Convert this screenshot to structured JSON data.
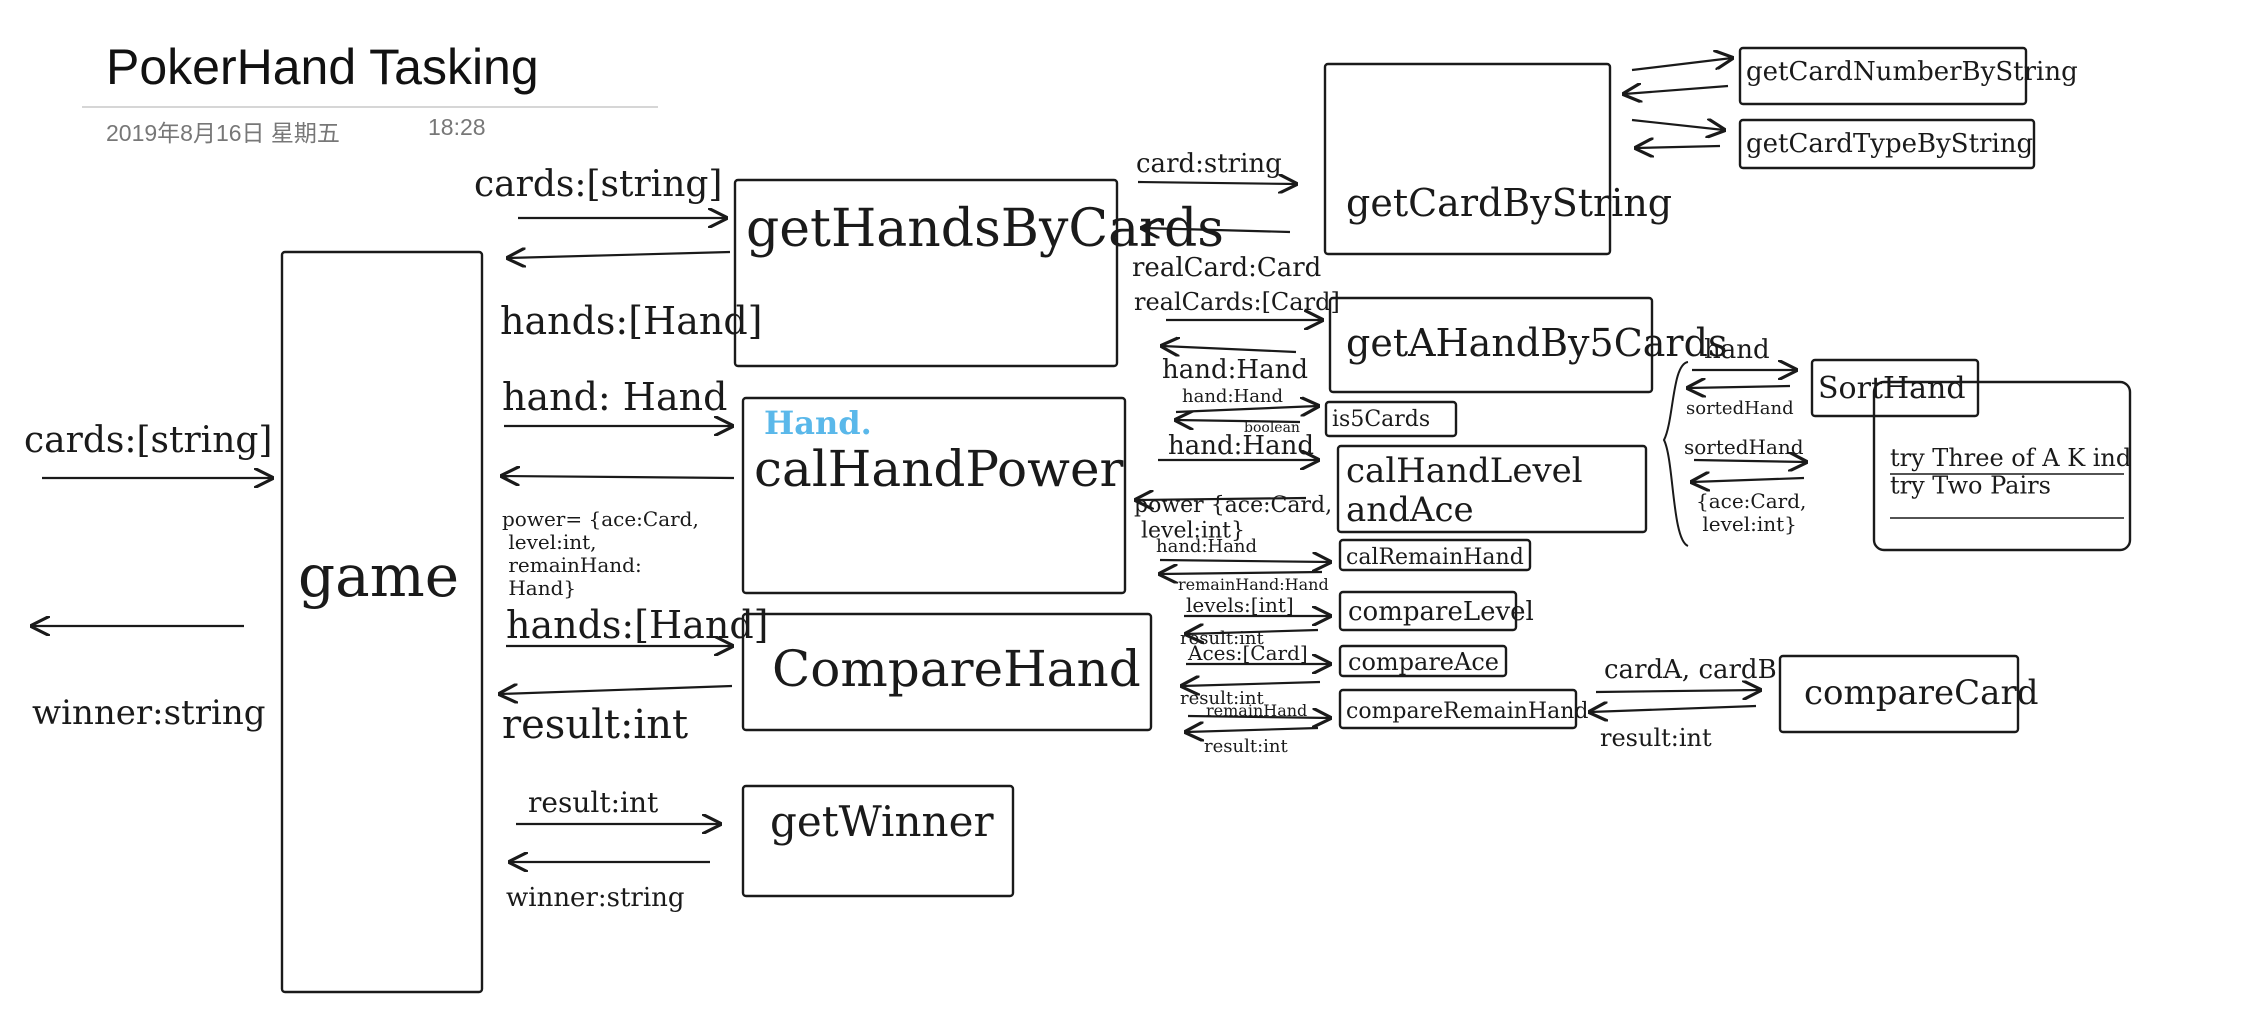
{
  "note": {
    "title": "PokerHand Tasking",
    "date": "2019年8月16日 星期五",
    "time": "18:28"
  },
  "colors": {
    "ink": "#1a1a1a",
    "highlight": "#5ab8ea",
    "rule": "#d6d6d6",
    "meta": "#777777"
  },
  "boxes": [
    {
      "id": "game",
      "label": "game"
    },
    {
      "id": "getHandsByCards",
      "label": "getHandsByCards"
    },
    {
      "id": "calHandPower",
      "label": "calHandPower"
    },
    {
      "id": "compareHand",
      "label": "CompareHand"
    },
    {
      "id": "getWinner",
      "label": "getWinner"
    },
    {
      "id": "getCardByString",
      "label": "getCardByString"
    },
    {
      "id": "getCardNumberByString",
      "label": "getCardNumberByString"
    },
    {
      "id": "getCardTypeByString",
      "label": "getCardTypeByString"
    },
    {
      "id": "getAHandBy5Cards",
      "label": "getAHandBy5Cards"
    },
    {
      "id": "is5Cards",
      "label": "is5Cards"
    },
    {
      "id": "calHandLevelAndAce",
      "label": "calHandLevel\nandAce"
    },
    {
      "id": "calRemainHand",
      "label": "calRemainHand"
    },
    {
      "id": "compareLevel",
      "label": "compareLevel"
    },
    {
      "id": "compareAce",
      "label": "compareAce"
    },
    {
      "id": "compareRemainHand",
      "label": "compareRemainHand"
    },
    {
      "id": "sortHand",
      "label": "SortHand"
    },
    {
      "id": "tryBox",
      "label": "try Three of A K ind\ntry Two Pairs"
    },
    {
      "id": "compareCard",
      "label": "compareCard"
    }
  ],
  "labels": [
    {
      "id": "cards_in",
      "text": "cards:[string]"
    },
    {
      "id": "winner_out",
      "text": "winner:string"
    },
    {
      "id": "cards_to_ghbc",
      "text": "cards:[string]"
    },
    {
      "id": "hands_from_ghbc",
      "text": "hands:[Hand]"
    },
    {
      "id": "hand_to_chp",
      "text": "hand: Hand"
    },
    {
      "id": "power_from_chp",
      "text": "power= {ace:Card,\n level:int,\n remainHand:\n Hand}"
    },
    {
      "id": "hands_to_ch",
      "text": "hands:[Hand]"
    },
    {
      "id": "result_from_ch",
      "text": "result:int"
    },
    {
      "id": "result_to_gw",
      "text": "result:int"
    },
    {
      "id": "winner_from_gw",
      "text": "winner:string"
    },
    {
      "id": "card_to_gcbs",
      "text": "card:string"
    },
    {
      "id": "realcard_from_gcbs",
      "text": "realCard:Card"
    },
    {
      "id": "realcards_to_gah",
      "text": "realCards:[Card]"
    },
    {
      "id": "hand_from_gah",
      "text": "hand:Hand"
    },
    {
      "id": "hand_to_is5",
      "text": "hand:Hand"
    },
    {
      "id": "boolean_from_is5",
      "text": "boolean"
    },
    {
      "id": "hand_to_chl",
      "text": "hand:Hand"
    },
    {
      "id": "power_from_chl",
      "text": "power {ace:Card,\n level:int}"
    },
    {
      "id": "hand_to_crh",
      "text": "hand:Hand"
    },
    {
      "id": "remain_from_crh",
      "text": "remainHand:Hand"
    },
    {
      "id": "levels_to_cl",
      "text": "levels:[int]"
    },
    {
      "id": "result_from_cl",
      "text": "result:int"
    },
    {
      "id": "aces_to_ca",
      "text": "Aces:[Card]"
    },
    {
      "id": "result_from_ca",
      "text": "result:int"
    },
    {
      "id": "remain_to_crmh",
      "text": "remainHand"
    },
    {
      "id": "result_from_crmh",
      "text": "result:int"
    },
    {
      "id": "hand_to_sort",
      "text": "hand"
    },
    {
      "id": "sorted_from_sort",
      "text": "sortedHand"
    },
    {
      "id": "sorted_to_try",
      "text": "sortedHand"
    },
    {
      "id": "acelevel_from_try",
      "text": "{ace:Card,\n level:int}"
    },
    {
      "id": "cards_to_cc",
      "text": "cardA, cardB"
    },
    {
      "id": "result_from_cc",
      "text": "result:int"
    },
    {
      "id": "hand_annotation",
      "text": "Hand."
    }
  ]
}
